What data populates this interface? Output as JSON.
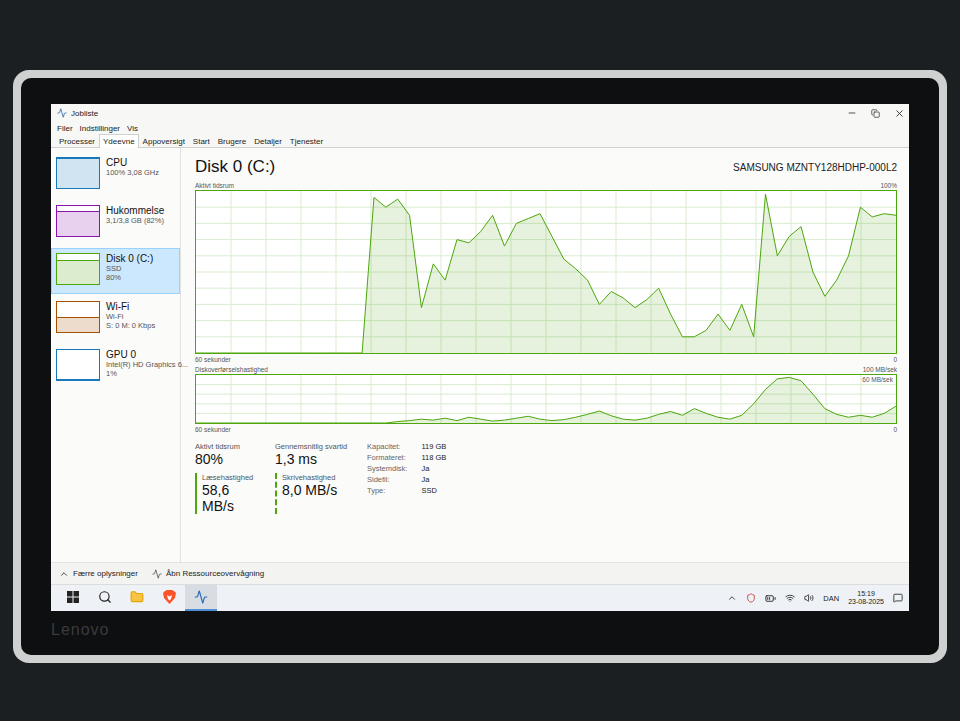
{
  "laptop": {
    "brand": "Lenovo"
  },
  "window": {
    "title": "Jobliste"
  },
  "menu": [
    "Filer",
    "Indstillinger",
    "Vis"
  ],
  "tabs": [
    {
      "label": "Processer",
      "selected": false
    },
    {
      "label": "Ydeevne",
      "selected": true
    },
    {
      "label": "Appoversigt",
      "selected": false
    },
    {
      "label": "Start",
      "selected": false
    },
    {
      "label": "Brugere",
      "selected": false
    },
    {
      "label": "Detaljer",
      "selected": false
    },
    {
      "label": "Tjenester",
      "selected": false
    }
  ],
  "sidebar": {
    "items": [
      {
        "name": "CPU",
        "lines": [
          "100% 3,08 GHz"
        ],
        "level": 1,
        "color": "#1779ba",
        "selected": false
      },
      {
        "name": "Hukommelse",
        "lines": [
          "3,1/3,8 GB (82%)"
        ],
        "level": 0.82,
        "color": "#8b12ae",
        "selected": false
      },
      {
        "name": "Disk 0 (C:)",
        "lines": [
          "SSD",
          "80%"
        ],
        "level": 0.8,
        "color": "#4da60c",
        "selected": true
      },
      {
        "name": "Wi-Fi",
        "lines": [
          "Wi-Fi",
          "S: 0 M: 0 Kbps"
        ],
        "level": 0.5,
        "color": "#a74f01",
        "selected": false
      },
      {
        "name": "GPU 0",
        "lines": [
          "Intel(R) HD Graphics 6...",
          "1%"
        ],
        "level": 0.01,
        "color": "#1779ba",
        "selected": false
      }
    ]
  },
  "panel": {
    "title": "Disk 0 (C:)",
    "model": "SAMSUNG MZNTY128HDHP-000L2"
  },
  "active_chart": {
    "label": "Aktivt tidsrum",
    "max_label": "100%",
    "time_label": "60 sekunder",
    "min_label": "0",
    "max": 100,
    "values": [
      0,
      0,
      0,
      0,
      0,
      0,
      0,
      0,
      0,
      0,
      0,
      0,
      0,
      0,
      0,
      96,
      90,
      95,
      85,
      28,
      55,
      45,
      70,
      68,
      75,
      85,
      66,
      80,
      83,
      86,
      72,
      58,
      52,
      45,
      30,
      38,
      34,
      28,
      33,
      40,
      24,
      10,
      10,
      14,
      24,
      14,
      30,
      10,
      98,
      60,
      72,
      78,
      50,
      35,
      45,
      60,
      90,
      84,
      86,
      85
    ]
  },
  "transfer_chart": {
    "label": "Diskoverførselshastighed",
    "max_label": "100 MB/sek",
    "mark_label": "60 MB/sek",
    "time_label": "60 sekunder",
    "min_label": "0",
    "max": 100,
    "values": [
      0,
      0,
      0,
      0,
      0,
      0,
      0,
      0,
      0,
      0,
      0,
      0,
      0,
      0,
      0,
      0,
      0,
      3,
      5,
      8,
      6,
      10,
      5,
      12,
      8,
      4,
      6,
      10,
      14,
      8,
      5,
      7,
      12,
      18,
      25,
      15,
      8,
      6,
      10,
      18,
      24,
      16,
      30,
      20,
      12,
      8,
      16,
      40,
      70,
      92,
      95,
      88,
      60,
      30,
      18,
      12,
      16,
      12,
      20,
      35
    ]
  },
  "stats": [
    {
      "label": "Aktivt tidsrum",
      "value": "80%",
      "kind": "plain"
    },
    {
      "label": "Gennemsnitlig svartid",
      "value": "1,3 ms",
      "kind": "plain"
    },
    {
      "label": "Læsehastighed",
      "value": "58,6 MB/s",
      "kind": "read"
    },
    {
      "label": "Skrivehastighed",
      "value": "8,0 MB/s",
      "kind": "write"
    }
  ],
  "properties": [
    {
      "label": "Kapacitet:",
      "value": "119 GB"
    },
    {
      "label": "Formateret:",
      "value": "118 GB"
    },
    {
      "label": "Systemdisk:",
      "value": "Ja"
    },
    {
      "label": "Sidefil:",
      "value": "Ja"
    },
    {
      "label": "Type:",
      "value": "SSD"
    }
  ],
  "footer": {
    "less": "Færre oplysninger",
    "resource": "Åbn Ressourceovervågning"
  },
  "taskbar": {
    "apps": [
      {
        "kind": "start",
        "selected": false
      },
      {
        "kind": "search",
        "selected": false
      },
      {
        "kind": "files",
        "selected": false
      },
      {
        "kind": "browser",
        "selected": false
      },
      {
        "kind": "taskmanager",
        "selected": true
      }
    ],
    "language": "DAN",
    "time": "15:19",
    "date": "23-08-2025"
  }
}
